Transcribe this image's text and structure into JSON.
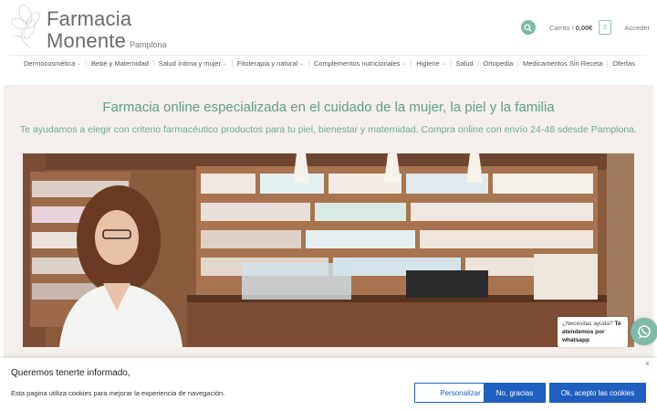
{
  "header": {
    "logo_line1": "Farmacia",
    "logo_line2": "Monente",
    "logo_sub": "Pamplona",
    "search_icon": "search-icon",
    "cart_label": "Carrito /",
    "cart_total": "0,00€",
    "cart_count": "0",
    "login": "Acceder"
  },
  "nav": {
    "items": [
      {
        "label": "Dermocosmética",
        "has_menu": true
      },
      {
        "label": "Bebé y Maternidad",
        "has_menu": false
      },
      {
        "label": "Salud íntima y mujer",
        "has_menu": true
      },
      {
        "label": "Fitoterapia y natural",
        "has_menu": true
      },
      {
        "label": "Complementos nutricionales",
        "has_menu": true
      },
      {
        "label": "Higiene",
        "has_menu": true
      },
      {
        "label": "Salud",
        "has_menu": false
      },
      {
        "label": "Ortopedia",
        "has_menu": false
      },
      {
        "label": "Medicamentos Sin Receta",
        "has_menu": false
      },
      {
        "label": "Ofertas",
        "has_menu": false
      }
    ]
  },
  "hero": {
    "title": "Farmacia online especializada en el cuidado de la mujer, la piel y la familia",
    "subtitle": "Te ayudamos a elegir con criterio farmacéutico productos para tu piel, bienestar y maternidad. Compra online con envío 24-48 sdesde Pamplona."
  },
  "whatsapp": {
    "question": "¿Necesitas ayuda?",
    "answer": "Te atendemos por whatsapp"
  },
  "cookie": {
    "title": "Queremos tenerte informado,",
    "text": "Esta pagina utiliza cookies para mejorar la experiencia de navegación.",
    "close": "×",
    "btn_personalizar": "Personalizar",
    "btn_no": "No, gracias",
    "btn_ok": "Ok, acepto las cookies"
  },
  "colors": {
    "accent": "#7fb9a8",
    "title": "#5fa08c",
    "hero_bg": "#f4efea",
    "button": "#1e5fbf"
  }
}
